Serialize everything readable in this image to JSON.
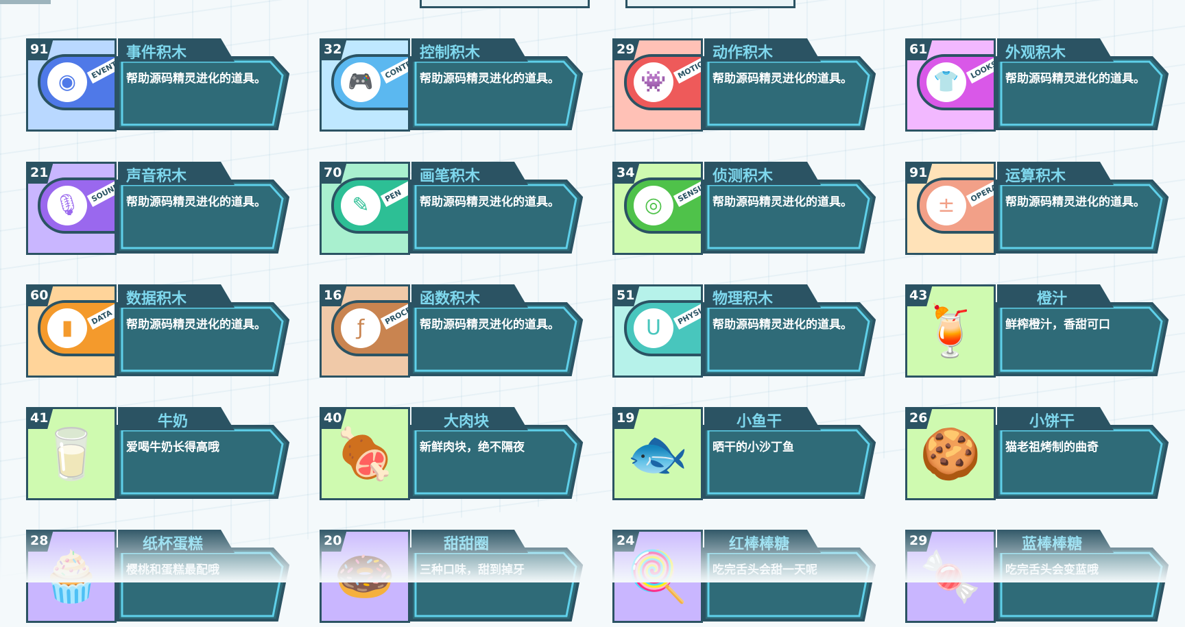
{
  "items": [
    {
      "count": "91",
      "title": "事件积木",
      "desc": "帮助源码精灵进化的道具。",
      "kind": "block",
      "tag": "EVENTS",
      "icon": "toggle-icon",
      "glyph": "◉",
      "bg": "#b9d8ff",
      "key": "#4f79e8"
    },
    {
      "count": "32",
      "title": "控制积木",
      "desc": "帮助源码精灵进化的道具。",
      "kind": "block",
      "tag": "CONTROL",
      "icon": "gamepad-icon",
      "glyph": "🎮",
      "bg": "#bfe8ff",
      "key": "#5bb8f0"
    },
    {
      "count": "29",
      "title": "动作积木",
      "desc": "帮助源码精灵进化的道具。",
      "kind": "block",
      "tag": "MOTION",
      "icon": "ghost-icon",
      "glyph": "👾",
      "bg": "#ffc1b6",
      "key": "#ee5a5a"
    },
    {
      "count": "61",
      "title": "外观积木",
      "desc": "帮助源码精灵进化的道具。",
      "kind": "block",
      "tag": "LOOKS",
      "icon": "shirt-icon",
      "glyph": "👕",
      "bg": "#f2b8ff",
      "key": "#d958e8"
    },
    {
      "count": "21",
      "title": "声音积木",
      "desc": "帮助源码精灵进化的道具。",
      "kind": "block",
      "tag": "SOUND",
      "icon": "microphone-icon",
      "glyph": "🎙",
      "bg": "#c9b6ff",
      "key": "#9a68ee"
    },
    {
      "count": "70",
      "title": "画笔积木",
      "desc": "帮助源码精灵进化的道具。",
      "kind": "block",
      "tag": "PEN",
      "icon": "pen-icon",
      "glyph": "✎",
      "bg": "#a9f0cf",
      "key": "#2dbf95"
    },
    {
      "count": "34",
      "title": "侦测积木",
      "desc": "帮助源码精灵进化的道具。",
      "kind": "block",
      "tag": "SENSING",
      "icon": "target-icon",
      "glyph": "◎",
      "bg": "#cffab0",
      "key": "#4fc24a"
    },
    {
      "count": "91",
      "title": "运算积木",
      "desc": "帮助源码精灵进化的道具。",
      "kind": "block",
      "tag": "OPERATOR",
      "icon": "calculator-icon",
      "glyph": "±",
      "bg": "#ffe2b8",
      "key": "#f2a088"
    },
    {
      "count": "60",
      "title": "数据积木",
      "desc": "帮助源码精灵进化的道具。",
      "kind": "block",
      "tag": "DATA",
      "icon": "bar-chart-icon",
      "glyph": "▮",
      "bg": "#ffd49a",
      "key": "#f49a2c"
    },
    {
      "count": "16",
      "title": "函数积木",
      "desc": "帮助源码精灵进化的道具。",
      "kind": "block",
      "tag": "PROCEDURE",
      "icon": "function-icon",
      "glyph": "ƒ",
      "bg": "#f0c9a8",
      "key": "#c98450"
    },
    {
      "count": "51",
      "title": "物理积木",
      "desc": "帮助源码精灵进化的道具。",
      "kind": "block",
      "tag": "PHYSICS",
      "icon": "magnet-icon",
      "glyph": "U",
      "bg": "#b6f2ea",
      "key": "#48c6bd"
    },
    {
      "count": "43",
      "title": "橙汁",
      "desc": "鲜榨橙汁，香甜可口",
      "kind": "food",
      "icon": "orange-juice-icon",
      "glyph": "🍹",
      "bg": "#cffab0"
    },
    {
      "count": "41",
      "title": "牛奶",
      "desc": "爱喝牛奶长得高哦",
      "kind": "food",
      "icon": "milk-carton-icon",
      "glyph": "🥛",
      "bg": "#cffab0"
    },
    {
      "count": "40",
      "title": "大肉块",
      "desc": "新鲜肉块，绝不隔夜",
      "kind": "food",
      "icon": "meat-icon",
      "glyph": "🍖",
      "bg": "#cffab0"
    },
    {
      "count": "19",
      "title": "小鱼干",
      "desc": "晒干的小沙丁鱼",
      "kind": "food",
      "icon": "fish-icon",
      "glyph": "🐟",
      "bg": "#cffab0"
    },
    {
      "count": "26",
      "title": "小饼干",
      "desc": "猫老祖烤制的曲奇",
      "kind": "food",
      "icon": "cookie-icon",
      "glyph": "🍪",
      "bg": "#cffab0"
    },
    {
      "count": "28",
      "title": "纸杯蛋糕",
      "desc": "樱桃和蛋糕最配哦",
      "kind": "food",
      "icon": "cupcake-icon",
      "glyph": "🧁",
      "bg": "#c9b6ff"
    },
    {
      "count": "20",
      "title": "甜甜圈",
      "desc": "三种口味，甜到掉牙",
      "kind": "food",
      "icon": "donut-icon",
      "glyph": "🍩",
      "bg": "#c9b6ff"
    },
    {
      "count": "24",
      "title": "红棒棒糖",
      "desc": "吃完舌头会甜一天呢",
      "kind": "food",
      "icon": "red-lollipop-icon",
      "glyph": "🍭",
      "bg": "#c9b6ff"
    },
    {
      "count": "29",
      "title": "蓝棒棒糖",
      "desc": "吃完舌头会变蓝哦",
      "kind": "food",
      "icon": "blue-lollipop-icon",
      "glyph": "🍬",
      "bg": "#c9b6ff"
    }
  ]
}
